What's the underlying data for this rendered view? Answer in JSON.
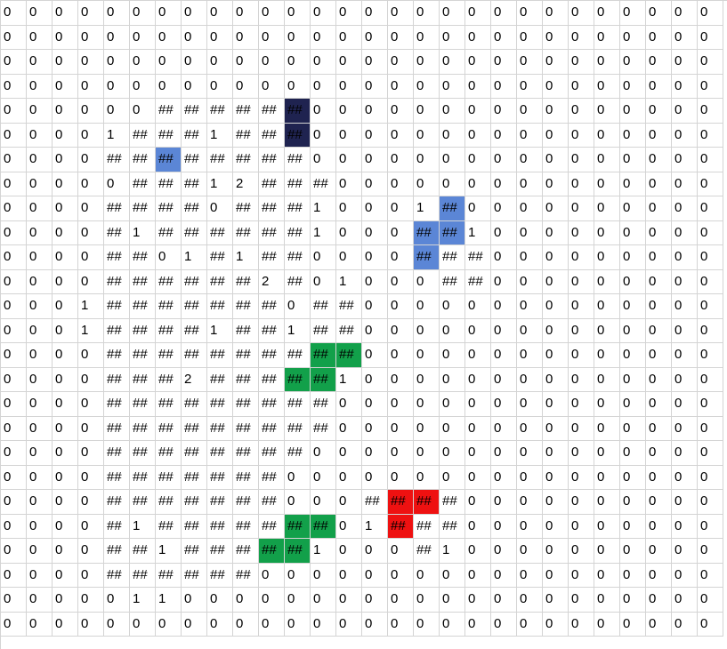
{
  "sheet": {
    "rows": [
      [
        "0",
        "0",
        "0",
        "0",
        "0",
        "0",
        "0",
        "0",
        "0",
        "0",
        "0",
        "0",
        "0",
        "0",
        "0",
        "0",
        "0",
        "0",
        "0",
        "0",
        "0",
        "0",
        "0",
        "0",
        "0",
        "0",
        "0",
        "0"
      ],
      [
        "0",
        "0",
        "0",
        "0",
        "0",
        "0",
        "0",
        "0",
        "0",
        "0",
        "0",
        "0",
        "0",
        "0",
        "0",
        "0",
        "0",
        "0",
        "0",
        "0",
        "0",
        "0",
        "0",
        "0",
        "0",
        "0",
        "0",
        "0"
      ],
      [
        "0",
        "0",
        "0",
        "0",
        "0",
        "0",
        "0",
        "0",
        "0",
        "0",
        "0",
        "0",
        "0",
        "0",
        "0",
        "0",
        "0",
        "0",
        "0",
        "0",
        "0",
        "0",
        "0",
        "0",
        "0",
        "0",
        "0",
        "0"
      ],
      [
        "0",
        "0",
        "0",
        "0",
        "0",
        "0",
        "0",
        "0",
        "0",
        "0",
        "0",
        "0",
        "0",
        "0",
        "0",
        "0",
        "0",
        "0",
        "0",
        "0",
        "0",
        "0",
        "0",
        "0",
        "0",
        "0",
        "0",
        "0"
      ],
      [
        "0",
        "0",
        "0",
        "0",
        "0",
        "0",
        "##",
        "##",
        "##",
        "##",
        "##",
        "##",
        "0",
        "0",
        "0",
        "0",
        "0",
        "0",
        "0",
        "0",
        "0",
        "0",
        "0",
        "0",
        "0",
        "0",
        "0",
        "0"
      ],
      [
        "0",
        "0",
        "0",
        "0",
        "1",
        "##",
        "##",
        "##",
        "1",
        "##",
        "##",
        "##",
        "0",
        "0",
        "0",
        "0",
        "0",
        "0",
        "0",
        "0",
        "0",
        "0",
        "0",
        "0",
        "0",
        "0",
        "0",
        "0"
      ],
      [
        "0",
        "0",
        "0",
        "0",
        "##",
        "##",
        "##",
        "##",
        "##",
        "##",
        "##",
        "##",
        "0",
        "0",
        "0",
        "0",
        "0",
        "0",
        "0",
        "0",
        "0",
        "0",
        "0",
        "0",
        "0",
        "0",
        "0",
        "0"
      ],
      [
        "0",
        "0",
        "0",
        "0",
        "0",
        "##",
        "##",
        "##",
        "1",
        "2",
        "##",
        "##",
        "##",
        "0",
        "0",
        "0",
        "0",
        "0",
        "0",
        "0",
        "0",
        "0",
        "0",
        "0",
        "0",
        "0",
        "0",
        "0"
      ],
      [
        "0",
        "0",
        "0",
        "0",
        "##",
        "##",
        "##",
        "##",
        "0",
        "##",
        "##",
        "##",
        "1",
        "0",
        "0",
        "0",
        "1",
        "##",
        "0",
        "0",
        "0",
        "0",
        "0",
        "0",
        "0",
        "0",
        "0",
        "0"
      ],
      [
        "0",
        "0",
        "0",
        "0",
        "##",
        "1",
        "##",
        "##",
        "##",
        "##",
        "##",
        "##",
        "1",
        "0",
        "0",
        "0",
        "##",
        "##",
        "1",
        "0",
        "0",
        "0",
        "0",
        "0",
        "0",
        "0",
        "0",
        "0"
      ],
      [
        "0",
        "0",
        "0",
        "0",
        "##",
        "##",
        "0",
        "1",
        "##",
        "1",
        "##",
        "##",
        "0",
        "0",
        "0",
        "0",
        "##",
        "##",
        "##",
        "0",
        "0",
        "0",
        "0",
        "0",
        "0",
        "0",
        "0",
        "0"
      ],
      [
        "0",
        "0",
        "0",
        "0",
        "##",
        "##",
        "##",
        "##",
        "##",
        "##",
        "2",
        "##",
        "0",
        "1",
        "0",
        "0",
        "0",
        "##",
        "##",
        "0",
        "0",
        "0",
        "0",
        "0",
        "0",
        "0",
        "0",
        "0"
      ],
      [
        "0",
        "0",
        "0",
        "1",
        "##",
        "##",
        "##",
        "##",
        "##",
        "##",
        "##",
        "0",
        "##",
        "##",
        "0",
        "0",
        "0",
        "0",
        "0",
        "0",
        "0",
        "0",
        "0",
        "0",
        "0",
        "0",
        "0",
        "0"
      ],
      [
        "0",
        "0",
        "0",
        "1",
        "##",
        "##",
        "##",
        "##",
        "1",
        "##",
        "##",
        "1",
        "##",
        "##",
        "0",
        "0",
        "0",
        "0",
        "0",
        "0",
        "0",
        "0",
        "0",
        "0",
        "0",
        "0",
        "0",
        "0"
      ],
      [
        "0",
        "0",
        "0",
        "0",
        "##",
        "##",
        "##",
        "##",
        "##",
        "##",
        "##",
        "##",
        "##",
        "##",
        "0",
        "0",
        "0",
        "0",
        "0",
        "0",
        "0",
        "0",
        "0",
        "0",
        "0",
        "0",
        "0",
        "0"
      ],
      [
        "0",
        "0",
        "0",
        "0",
        "##",
        "##",
        "##",
        "2",
        "##",
        "##",
        "##",
        "##",
        "##",
        "1",
        "0",
        "0",
        "0",
        "0",
        "0",
        "0",
        "0",
        "0",
        "0",
        "0",
        "0",
        "0",
        "0",
        "0"
      ],
      [
        "0",
        "0",
        "0",
        "0",
        "##",
        "##",
        "##",
        "##",
        "##",
        "##",
        "##",
        "##",
        "##",
        "0",
        "0",
        "0",
        "0",
        "0",
        "0",
        "0",
        "0",
        "0",
        "0",
        "0",
        "0",
        "0",
        "0",
        "0"
      ],
      [
        "0",
        "0",
        "0",
        "0",
        "##",
        "##",
        "##",
        "##",
        "##",
        "##",
        "##",
        "##",
        "##",
        "0",
        "0",
        "0",
        "0",
        "0",
        "0",
        "0",
        "0",
        "0",
        "0",
        "0",
        "0",
        "0",
        "0",
        "0"
      ],
      [
        "0",
        "0",
        "0",
        "0",
        "##",
        "##",
        "##",
        "##",
        "##",
        "##",
        "##",
        "##",
        "0",
        "0",
        "0",
        "0",
        "0",
        "0",
        "0",
        "0",
        "0",
        "0",
        "0",
        "0",
        "0",
        "0",
        "0",
        "0"
      ],
      [
        "0",
        "0",
        "0",
        "0",
        "##",
        "##",
        "##",
        "##",
        "##",
        "##",
        "##",
        "0",
        "0",
        "0",
        "0",
        "0",
        "0",
        "0",
        "0",
        "0",
        "0",
        "0",
        "0",
        "0",
        "0",
        "0",
        "0",
        "0"
      ],
      [
        "0",
        "0",
        "0",
        "0",
        "##",
        "##",
        "##",
        "##",
        "##",
        "##",
        "##",
        "0",
        "0",
        "0",
        "##",
        "##",
        "##",
        "##",
        "0",
        "0",
        "0",
        "0",
        "0",
        "0",
        "0",
        "0",
        "0",
        "0"
      ],
      [
        "0",
        "0",
        "0",
        "0",
        "##",
        "1",
        "##",
        "##",
        "##",
        "##",
        "##",
        "##",
        "##",
        "0",
        "1",
        "##",
        "##",
        "##",
        "0",
        "0",
        "0",
        "0",
        "0",
        "0",
        "0",
        "0",
        "0",
        "0"
      ],
      [
        "0",
        "0",
        "0",
        "0",
        "##",
        "##",
        "1",
        "##",
        "##",
        "##",
        "##",
        "##",
        "1",
        "0",
        "0",
        "0",
        "##",
        "1",
        "0",
        "0",
        "0",
        "0",
        "0",
        "0",
        "0",
        "0",
        "0",
        "0"
      ],
      [
        "0",
        "0",
        "0",
        "0",
        "##",
        "##",
        "##",
        "##",
        "##",
        "##",
        "0",
        "0",
        "0",
        "0",
        "0",
        "0",
        "0",
        "0",
        "0",
        "0",
        "0",
        "0",
        "0",
        "0",
        "0",
        "0",
        "0",
        "0"
      ],
      [
        "0",
        "0",
        "0",
        "0",
        "0",
        "1",
        "1",
        "0",
        "0",
        "0",
        "0",
        "0",
        "0",
        "0",
        "0",
        "0",
        "0",
        "0",
        "0",
        "0",
        "0",
        "0",
        "0",
        "0",
        "0",
        "0",
        "0",
        "0"
      ],
      [
        "0",
        "0",
        "0",
        "0",
        "0",
        "0",
        "0",
        "0",
        "0",
        "0",
        "0",
        "0",
        "0",
        "0",
        "0",
        "0",
        "0",
        "0",
        "0",
        "0",
        "0",
        "0",
        "0",
        "0",
        "0",
        "0",
        "0",
        "0"
      ]
    ],
    "highlights": [
      {
        "row": 4,
        "col": 11,
        "color": "#1f2350",
        "label": "dark-navy"
      },
      {
        "row": 5,
        "col": 11,
        "color": "#1f2350",
        "label": "dark-navy"
      },
      {
        "row": 6,
        "col": 6,
        "color": "#5b86d6",
        "label": "blue"
      },
      {
        "row": 8,
        "col": 17,
        "color": "#5b86d6",
        "label": "blue"
      },
      {
        "row": 9,
        "col": 16,
        "color": "#5b86d6",
        "label": "blue"
      },
      {
        "row": 9,
        "col": 17,
        "color": "#5b86d6",
        "label": "blue"
      },
      {
        "row": 10,
        "col": 16,
        "color": "#5b86d6",
        "label": "blue"
      },
      {
        "row": 14,
        "col": 12,
        "color": "#12a04a",
        "label": "green"
      },
      {
        "row": 14,
        "col": 13,
        "color": "#12a04a",
        "label": "green"
      },
      {
        "row": 15,
        "col": 11,
        "color": "#12a04a",
        "label": "green"
      },
      {
        "row": 15,
        "col": 12,
        "color": "#12a04a",
        "label": "green"
      },
      {
        "row": 20,
        "col": 15,
        "color": "#ee1111",
        "label": "red"
      },
      {
        "row": 20,
        "col": 16,
        "color": "#ee1111",
        "label": "red"
      },
      {
        "row": 21,
        "col": 11,
        "color": "#12a04a",
        "label": "green"
      },
      {
        "row": 21,
        "col": 12,
        "color": "#12a04a",
        "label": "green"
      },
      {
        "row": 21,
        "col": 15,
        "color": "#ee1111",
        "label": "red"
      },
      {
        "row": 22,
        "col": 10,
        "color": "#12a04a",
        "label": "green"
      },
      {
        "row": 22,
        "col": 11,
        "color": "#12a04a",
        "label": "green"
      }
    ]
  }
}
